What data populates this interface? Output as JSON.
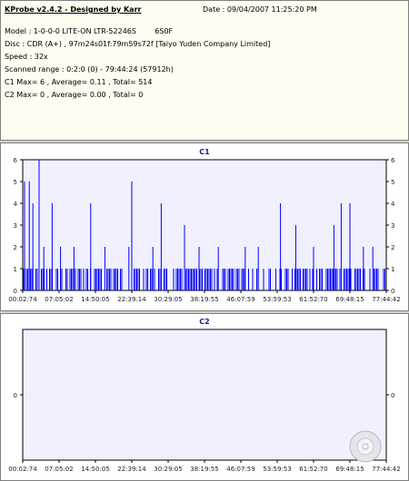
{
  "info": {
    "title": "KProbe v2.4.2 - Designed by Karr",
    "date": "Date : 09/04/2007 11:25:20 PM",
    "model": "Model : 1-0-0-0 LITE-ON LTR-52246S        6S0F",
    "disc": "Disc : CDR (A+) , 97m24s01f:79m59s72f [Taiyo Yuden Company Limited]",
    "speed": "Speed : 32x",
    "range": "Scanned range : 0:2:0 (0) - 79:44:24 (57912h)",
    "c1": "C1 Max= 6 , Average= 0.11 , Total= 514",
    "c2": "C2 Max= 0 , Average= 0.00 , Total= 0"
  },
  "chart_data": [
    {
      "type": "bar",
      "title": "C1",
      "ylim": [
        0,
        6
      ],
      "yticks": [
        0,
        1,
        2,
        3,
        4,
        5,
        6
      ],
      "xlabels": [
        "00:02:74",
        "07:05:02",
        "14:50:05",
        "22:39:14",
        "30:29:05",
        "38:19:55",
        "46:07:59",
        "53:59:53",
        "61:52:70",
        "69:48:15",
        "77:44:42"
      ],
      "spikes": [
        {
          "t": 0.005,
          "v": 5
        },
        {
          "t": 0.018,
          "v": 5
        },
        {
          "t": 0.028,
          "v": 4
        },
        {
          "t": 0.045,
          "v": 6
        },
        {
          "t": 0.058,
          "v": 2
        },
        {
          "t": 0.081,
          "v": 4
        },
        {
          "t": 0.104,
          "v": 2
        },
        {
          "t": 0.141,
          "v": 2
        },
        {
          "t": 0.187,
          "v": 4
        },
        {
          "t": 0.226,
          "v": 2
        },
        {
          "t": 0.292,
          "v": 2
        },
        {
          "t": 0.3,
          "v": 5
        },
        {
          "t": 0.358,
          "v": 2
        },
        {
          "t": 0.381,
          "v": 4
        },
        {
          "t": 0.445,
          "v": 3
        },
        {
          "t": 0.485,
          "v": 2
        },
        {
          "t": 0.538,
          "v": 2
        },
        {
          "t": 0.612,
          "v": 2
        },
        {
          "t": 0.648,
          "v": 2
        },
        {
          "t": 0.709,
          "v": 4
        },
        {
          "t": 0.751,
          "v": 3
        },
        {
          "t": 0.8,
          "v": 2
        },
        {
          "t": 0.856,
          "v": 3
        },
        {
          "t": 0.876,
          "v": 4
        },
        {
          "t": 0.9,
          "v": 4
        },
        {
          "t": 0.937,
          "v": 2
        },
        {
          "t": 0.963,
          "v": 2
        }
      ],
      "baseline_density": 0.55
    },
    {
      "type": "bar",
      "title": "C2",
      "ylim": [
        -1,
        1
      ],
      "yticks": [
        0
      ],
      "xlabels": [
        "00:02:74",
        "07:05:02",
        "14:50:05",
        "22:39:14",
        "30:29:05",
        "38:19:55",
        "46:07:59",
        "53:59:53",
        "61:52:70",
        "69:48:15",
        "77:44:42"
      ],
      "values": [
        0
      ]
    }
  ],
  "colors": {
    "plot_bg": "#f0f0ff",
    "bar": "#0000ff",
    "border": "#808080",
    "info_bg": "#fefdf0"
  }
}
